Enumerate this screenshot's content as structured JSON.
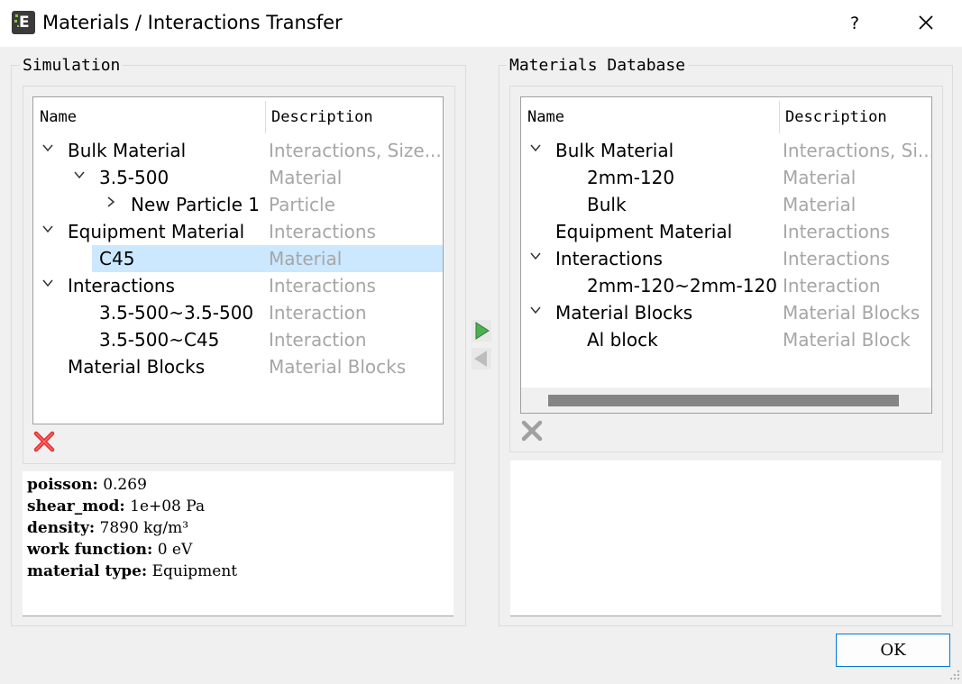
{
  "window": {
    "title": "Materials / Interactions Transfer",
    "help_label": "?"
  },
  "simulation": {
    "group_label": "Simulation",
    "columns": [
      "Name",
      "Description"
    ],
    "rows": [
      {
        "name": "Bulk Material",
        "description": "Interactions, Size...",
        "expander": "expanded"
      },
      {
        "name": "3.5-500",
        "description": "Material",
        "expander": "expanded"
      },
      {
        "name": "New Particle 1",
        "description": "Particle",
        "expander": "collapsed"
      },
      {
        "name": "Equipment Material",
        "description": "Interactions",
        "expander": "expanded"
      },
      {
        "name": "C45",
        "description": "Material",
        "expander": "none",
        "selected": true
      },
      {
        "name": "Interactions",
        "description": "Interactions",
        "expander": "expanded"
      },
      {
        "name": "3.5-500~3.5-500",
        "description": "Interaction",
        "expander": "none"
      },
      {
        "name": "3.5-500~C45",
        "description": "Interaction",
        "expander": "none"
      },
      {
        "name": "Material Blocks",
        "description": "Material Blocks",
        "expander": "none"
      }
    ],
    "delete_icon": "red-x-icon",
    "properties": [
      {
        "key": "poisson:",
        "value": "0.269"
      },
      {
        "key": "shear_mod:",
        "value": "1e+08 Pa"
      },
      {
        "key": "density:",
        "value": "7890 kg/m³"
      },
      {
        "key": "work function:",
        "value": "0 eV"
      },
      {
        "key": "material type:",
        "value": "Equipment"
      }
    ]
  },
  "transfer": {
    "right_arrow_icon": "arrow-right-icon",
    "left_arrow_icon": "arrow-left-icon"
  },
  "database": {
    "group_label": "Materials Database",
    "columns": [
      "Name",
      "Description"
    ],
    "rows": [
      {
        "name": "Bulk Material",
        "description": "Interactions, Si...",
        "expander": "expanded"
      },
      {
        "name": "2mm-120",
        "description": "Material",
        "expander": "none"
      },
      {
        "name": "Bulk",
        "description": "Material",
        "expander": "none"
      },
      {
        "name": "Equipment Material",
        "description": "Interactions",
        "expander": "none"
      },
      {
        "name": "Interactions",
        "description": "Interactions",
        "expander": "expanded"
      },
      {
        "name": "2mm-120~2mm-120",
        "description": "Interaction",
        "expander": "none"
      },
      {
        "name": "Material Blocks",
        "description": "Material Blocks",
        "expander": "expanded"
      },
      {
        "name": "Al block",
        "description": "Material Block",
        "expander": "none"
      }
    ],
    "delete_icon": "gray-x-icon"
  },
  "footer": {
    "ok_label": "OK"
  },
  "colors": {
    "selection": "#cce8ff",
    "description_text": "#a6a6a6",
    "accent": "#0078d4",
    "arrow_active": "#4caf50"
  }
}
